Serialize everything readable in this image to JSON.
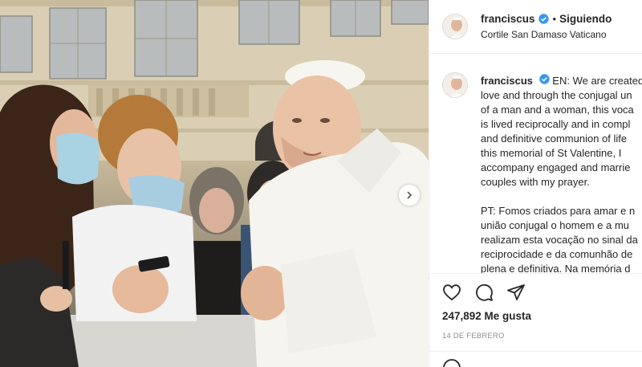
{
  "post": {
    "username": "franciscus",
    "follow_label": "Siguiendo",
    "dot": "•",
    "location": "Cortile San Damaso Vaticano",
    "caption_en": [
      "EN: We are created",
      "love and through the conjugal un",
      "of a man and a woman, this voca",
      "is lived reciprocally and in compl",
      "and definitive communion of life",
      "this memorial of St Valentine, I",
      "accompany engaged and marrie",
      "couples with my prayer."
    ],
    "caption_pt": [
      "PT: Fomos criados para amar e n",
      "união conjugal o homem e a mu",
      "realizam esta vocação no sinal da",
      "reciprocidade e da comunhão de",
      "plena e definitiva. Na memória d"
    ],
    "likes": "247,892 Me gusta",
    "date": "14 DE FEBRERO"
  },
  "icons": {
    "verified": "verified-badge-icon",
    "like": "heart-icon",
    "comment": "comment-icon",
    "share": "paper-plane-icon",
    "next": "chevron-right-icon",
    "emoji": "emoji-icon"
  },
  "colors": {
    "verified": "#3897f0",
    "border": "#efefef",
    "muted": "#8e8e8e"
  }
}
